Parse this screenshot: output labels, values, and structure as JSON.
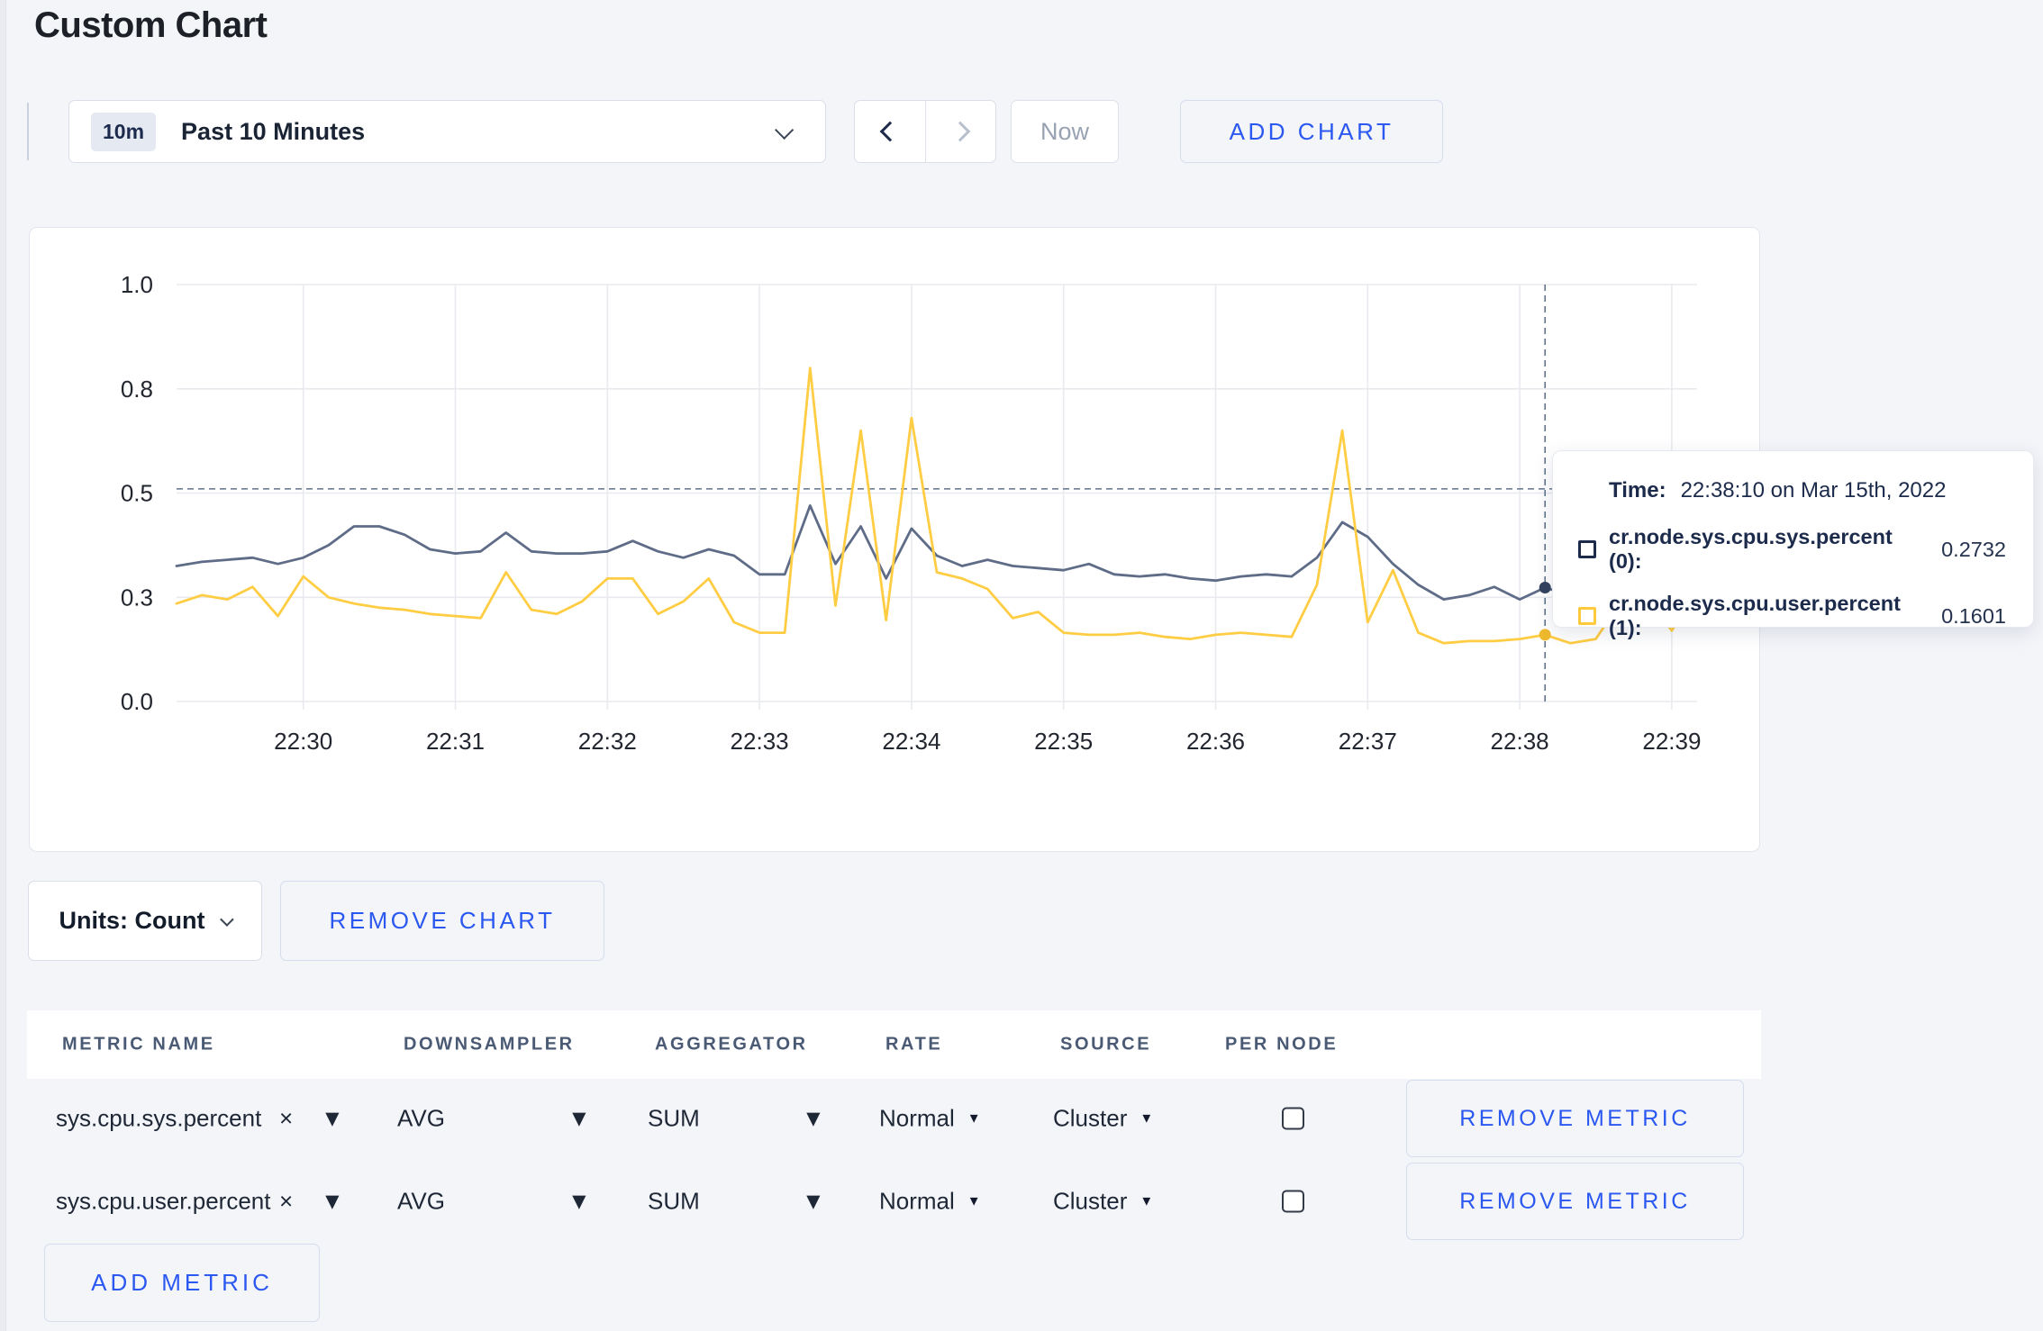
{
  "page": {
    "title": "Custom Chart"
  },
  "toolbar": {
    "time_range": {
      "badge": "10m",
      "label": "Past 10 Minutes"
    },
    "now_label": "Now",
    "add_chart_label": "ADD CHART"
  },
  "chart_controls": {
    "units_label": "Units: Count",
    "remove_chart_label": "REMOVE CHART",
    "remove_metric_label": "REMOVE METRIC",
    "add_metric_label": "ADD METRIC"
  },
  "tooltip": {
    "time_label": "Time:",
    "time_value": "22:38:10 on Mar 15th, 2022",
    "series": [
      {
        "name": "cr.node.sys.cpu.sys.percent (0):",
        "value": "0.2732",
        "swatch_color": "#1c2b4c"
      },
      {
        "name": "cr.node.sys.cpu.user.percent (1):",
        "value": "0.1601",
        "swatch_color": "#ffc93d"
      }
    ]
  },
  "metrics_table": {
    "headers": [
      "METRIC NAME",
      "DOWNSAMPLER",
      "AGGREGATOR",
      "RATE",
      "SOURCE",
      "PER NODE"
    ],
    "rows": [
      {
        "metric": "sys.cpu.sys.percent",
        "downsampler": "AVG",
        "aggregator": "SUM",
        "rate": "Normal",
        "source": "Cluster",
        "per_node_checked": false
      },
      {
        "metric": "sys.cpu.user.percent",
        "downsampler": "AVG",
        "aggregator": "SUM",
        "rate": "Normal",
        "source": "Cluster",
        "per_node_checked": false
      }
    ]
  },
  "icons": {
    "caret_down": "▼",
    "close": "×"
  },
  "chart_data": {
    "type": "line",
    "title": "",
    "xlabel": "",
    "ylabel": "",
    "x_start": "22:29:10",
    "x_end": "22:39:10",
    "step_seconds": 10,
    "ylim": [
      0,
      1
    ],
    "grid": true,
    "legend_position": "tooltip",
    "y_ticks": [
      {
        "label": "1.0",
        "v": 1.0
      },
      {
        "label": "0.8",
        "v": 0.75
      },
      {
        "label": "0.5",
        "v": 0.5
      },
      {
        "label": "0.3",
        "v": 0.25
      },
      {
        "label": "0.0",
        "v": 0.0
      }
    ],
    "x_ticks": [
      {
        "label": "22:30",
        "i": 5
      },
      {
        "label": "22:31",
        "i": 11
      },
      {
        "label": "22:32",
        "i": 17
      },
      {
        "label": "22:33",
        "i": 23
      },
      {
        "label": "22:34",
        "i": 29
      },
      {
        "label": "22:35",
        "i": 35
      },
      {
        "label": "22:36",
        "i": 41
      },
      {
        "label": "22:37",
        "i": 47
      },
      {
        "label": "22:38",
        "i": 53
      },
      {
        "label": "22:39",
        "i": 59
      }
    ],
    "crosshair": {
      "time": "22:38:10",
      "index": 54,
      "cross_y": 0.51
    },
    "series": [
      {
        "name": "cr.node.sys.cpu.sys.percent",
        "color": "#5f6c87",
        "dot_color": "#33445f",
        "values": [
          0.325,
          0.335,
          0.34,
          0.345,
          0.33,
          0.345,
          0.375,
          0.42,
          0.42,
          0.4,
          0.365,
          0.355,
          0.36,
          0.405,
          0.36,
          0.355,
          0.355,
          0.36,
          0.385,
          0.36,
          0.345,
          0.365,
          0.35,
          0.305,
          0.305,
          0.47,
          0.33,
          0.42,
          0.295,
          0.415,
          0.35,
          0.325,
          0.34,
          0.325,
          0.32,
          0.315,
          0.33,
          0.305,
          0.3,
          0.305,
          0.295,
          0.29,
          0.3,
          0.305,
          0.3,
          0.345,
          0.43,
          0.395,
          0.33,
          0.28,
          0.245,
          0.255,
          0.275,
          0.245,
          0.2732,
          0.255,
          0.265,
          0.28,
          0.27,
          0.285,
          0.3
        ]
      },
      {
        "name": "cr.node.sys.cpu.user.percent",
        "color": "#ffcd44",
        "dot_color": "#f0ba2e",
        "values": [
          0.235,
          0.255,
          0.245,
          0.275,
          0.205,
          0.3,
          0.25,
          0.235,
          0.225,
          0.22,
          0.21,
          0.205,
          0.2,
          0.31,
          0.22,
          0.21,
          0.24,
          0.295,
          0.295,
          0.21,
          0.24,
          0.295,
          0.19,
          0.165,
          0.165,
          0.8,
          0.23,
          0.65,
          0.195,
          0.68,
          0.31,
          0.295,
          0.27,
          0.2,
          0.215,
          0.165,
          0.16,
          0.16,
          0.165,
          0.155,
          0.15,
          0.16,
          0.165,
          0.16,
          0.155,
          0.28,
          0.65,
          0.19,
          0.315,
          0.165,
          0.14,
          0.145,
          0.145,
          0.15,
          0.1601,
          0.14,
          0.15,
          0.24,
          0.25,
          0.17,
          0.27
        ]
      }
    ]
  }
}
